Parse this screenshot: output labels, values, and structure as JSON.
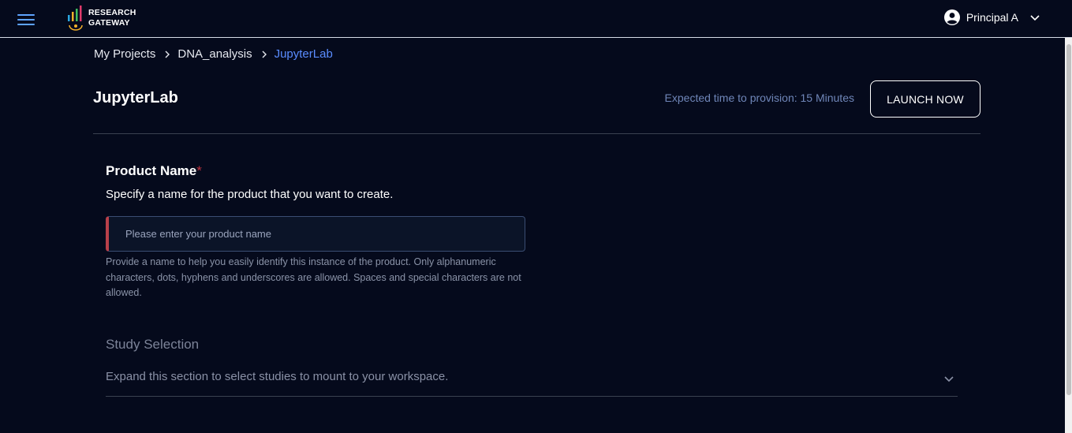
{
  "header": {
    "logo_line1": "RESEARCH",
    "logo_line2": "GATEWAY",
    "user_name": "Principal A",
    "icons": {
      "menu": "hamburger-menu-icon",
      "user": "account-circle-icon",
      "dropdown": "chevron-down-icon"
    }
  },
  "breadcrumb": {
    "items": [
      "My Projects",
      "DNA_analysis"
    ],
    "current": "JupyterLab"
  },
  "page": {
    "title": "JupyterLab",
    "provision_text": "Expected time to provision: 15 Minutes",
    "launch_label": "LAUNCH NOW"
  },
  "product_name": {
    "label": "Product Name",
    "required_mark": "*",
    "description": "Specify a name for the product that you want to create.",
    "placeholder": "Please enter your product name",
    "value": "",
    "helper": "Provide a name to help you easily identify this instance of the product. Only alphanumeric characters, dots, hyphens and underscores are allowed. Spaces and special characters are not allowed."
  },
  "study_selection": {
    "title": "Study Selection",
    "description": "Expand this section to select studies to mount to your workspace."
  },
  "colors": {
    "background": "#050a1c",
    "accent_link": "#5a8cff",
    "required": "#c0343f",
    "menu_icon": "#5ea3ff"
  }
}
